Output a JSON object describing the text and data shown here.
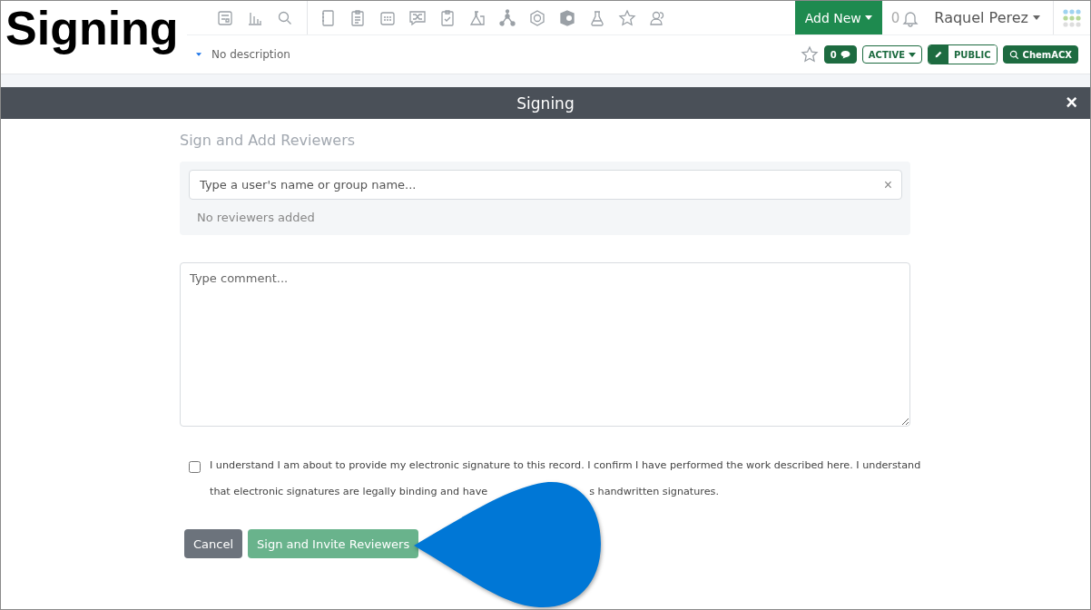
{
  "caption": "Signing",
  "header": {
    "add_new": "Add New",
    "notification_count": "0",
    "user": "Raquel Perez"
  },
  "record": {
    "description": "No description",
    "comment_count": "0",
    "status": "ACTIVE",
    "visibility": "PUBLIC",
    "search_link": "ChemACX",
    "favorite": false
  },
  "modal": {
    "title": "Signing",
    "close": "×",
    "section_title": "Sign and Add Reviewers",
    "reviewer_search": {
      "placeholder": "Type a user's name or group name...",
      "clear": "×"
    },
    "reviewers_empty": "No reviewers added",
    "comment": {
      "placeholder": "Type comment..."
    },
    "agreement": {
      "checked": false,
      "line_1": "I understand I am about to provide my electronic signature to this record. I confirm I have performed the work described here. I understand",
      "line_2_start": "that electronic signatures are legally binding and have",
      "line_2_end": "s handwritten signatures."
    },
    "buttons": [
      {
        "label": "Cancel",
        "kind": "secondary"
      },
      {
        "label": "Sign and Invite Reviewers",
        "kind": "primary",
        "disabled": true
      }
    ]
  }
}
